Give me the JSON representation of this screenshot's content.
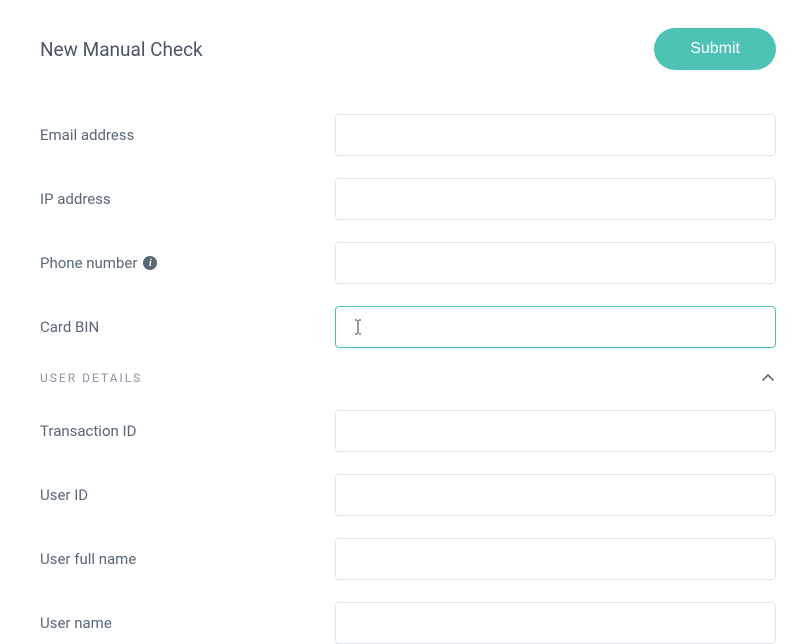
{
  "header": {
    "title": "New Manual Check",
    "submit_label": "Submit"
  },
  "fields": {
    "email": {
      "label": "Email address",
      "value": ""
    },
    "ip": {
      "label": "IP address",
      "value": ""
    },
    "phone": {
      "label": "Phone number",
      "value": ""
    },
    "card_bin": {
      "label": "Card BIN",
      "value": ""
    }
  },
  "section": {
    "title": "USER DETAILS"
  },
  "user_fields": {
    "transaction_id": {
      "label": "Transaction ID",
      "value": ""
    },
    "user_id": {
      "label": "User ID",
      "value": ""
    },
    "user_full_name": {
      "label": "User full name",
      "value": ""
    },
    "user_name": {
      "label": "User name",
      "value": ""
    }
  }
}
